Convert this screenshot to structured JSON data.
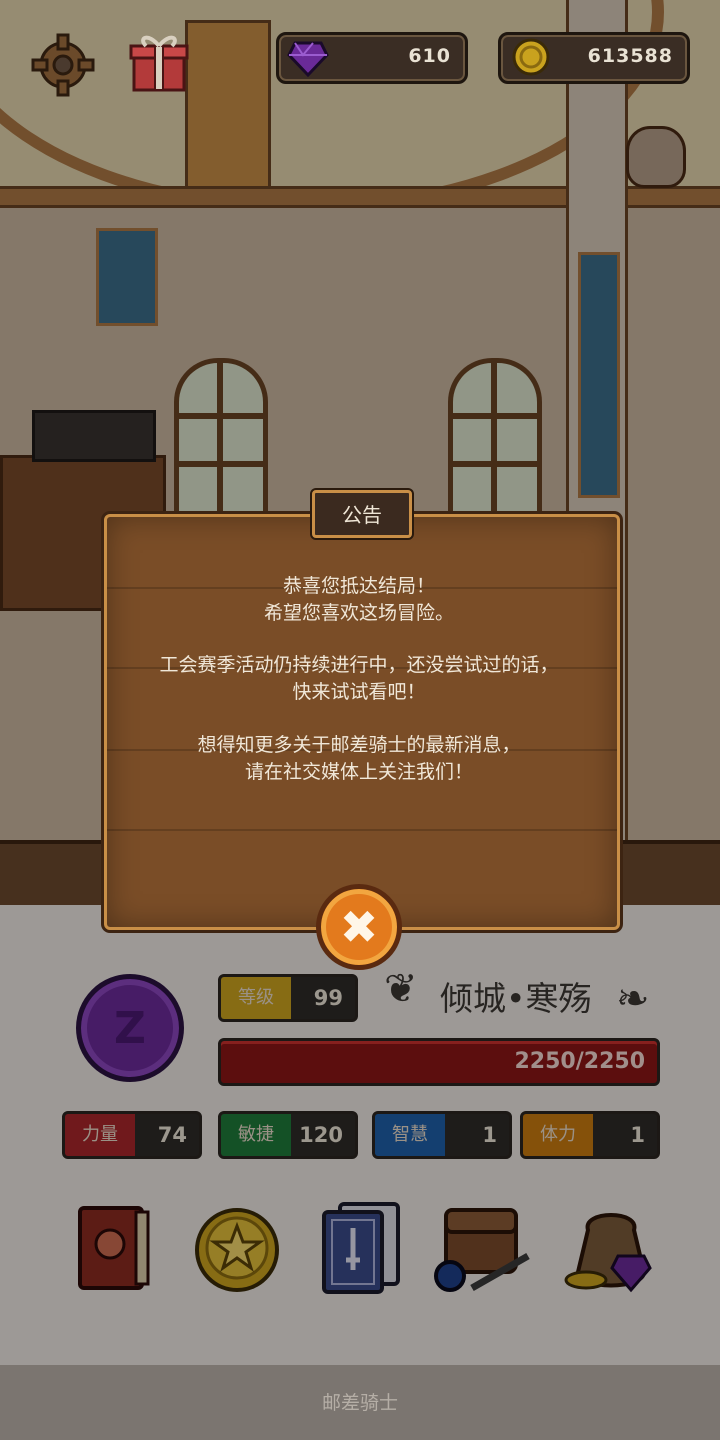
{
  "hud": {
    "gems": "610",
    "gold": "613588"
  },
  "dialog": {
    "title": "公告",
    "lines": [
      "恭喜您抵达结局！",
      "希望您喜欢这场冒险。",
      "工会赛季活动仍持续进行中，还没尝试过的话，",
      "快来试试看吧！",
      "想得知更多关于邮差骑士的最新消息，",
      "请在社交媒体上关注我们！"
    ],
    "close_glyph": "✖"
  },
  "character": {
    "medal_glyph": "Z",
    "level_label": "等级",
    "level": "99",
    "name": "倾城•寒殇",
    "hp": "2250/2250",
    "stats": [
      {
        "label": "力量",
        "value": "74",
        "color": "#a8262a"
      },
      {
        "label": "敏捷",
        "value": "120",
        "color": "#1e7a3a"
      },
      {
        "label": "智慧",
        "value": "1",
        "color": "#1f5fa8"
      },
      {
        "label": "体力",
        "value": "1",
        "color": "#c77a10"
      }
    ]
  },
  "nav": [
    "book-icon",
    "star-coin-icon",
    "cards-icon",
    "bag-icon",
    "treasure-icon"
  ],
  "footer": "邮差骑士"
}
